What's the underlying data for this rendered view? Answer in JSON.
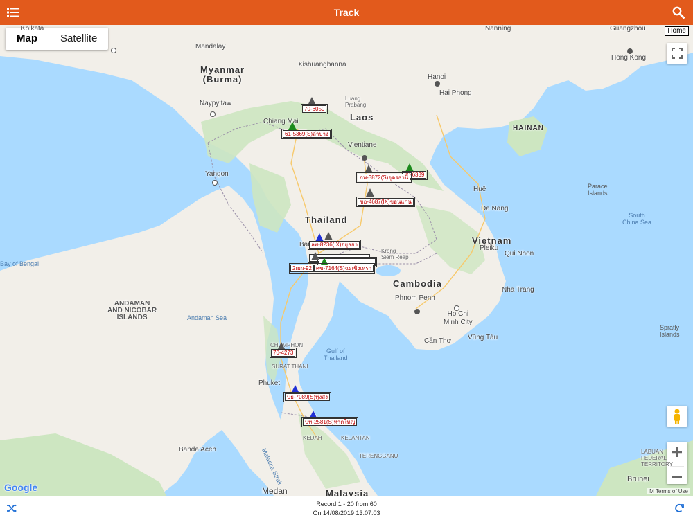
{
  "header": {
    "title": "Track"
  },
  "map_toggle": {
    "map": "Map",
    "satellite": "Satellite",
    "selected": "Map"
  },
  "home_label": "Home",
  "labels": {
    "myanmar": "Myanmar\n(Burma)",
    "laos": "Laos",
    "thailand": "Thailand",
    "cambodia": "Cambodia",
    "vietnam": "Vietnam",
    "malaysia": "Malaysia",
    "hainan": "HAINAN",
    "mandalay": "Mandalay",
    "naypyitaw": "Naypyitaw",
    "yangon": "Yangon",
    "chiang_mai": "Chiang Mai",
    "vientiane": "Vientiane",
    "hanoi": "Hanoi",
    "hai_phong": "Hai Phong",
    "hong_kong": "Hong Kong",
    "nanning": "Nanning",
    "guangzhou": "Guangzhou",
    "da_nang": "Da Nang",
    "hue": "Huế",
    "pleiku": "Pleiku",
    "qui_nhon": "Qui Nhon",
    "nha_trang": "Nha Trang",
    "ho_chi_minh": "Ho Chi\nMinh City",
    "phnom_penh": "Phnom Penh",
    "siem_reap": "Krong\nSiem Reap",
    "can_tho": "Cần Thơ",
    "vung_tau": "Vũng Tàu",
    "bangkok": "Bangkok",
    "banda_aceh": "Banda Aceh",
    "medan": "Medan",
    "kolkata": "Kolkata",
    "andaman_islands": "ANDAMAN\nAND NICOBAR\nISLANDS",
    "andaman_sea": "Andaman Sea",
    "gulf_thailand": "Gulf of\nThailand",
    "bay_bengal": "Bay of Bengal",
    "south_china_sea": "South\nChina Sea",
    "paracel": "Paracel\nIslands",
    "spratly": "Spratly\nIslands",
    "brunei": "Brunei",
    "malacca": "Malacca Strait",
    "xishuangbanna": "Xishuangbanna",
    "luang_prabang": "Luang\nPrabang",
    "surat_thani": "SURAT THANI",
    "chumphon": "CHUMPHON",
    "phuket": "Phuket",
    "kedah": "KEDAH",
    "kelantan": "KELANTAN",
    "terengganu": "TERENGGANU",
    "sabah": "LABUAN\nFEDERAL\nTERRITORY"
  },
  "vehicles": [
    {
      "id": "v1",
      "label": "70-6059",
      "color": "gray"
    },
    {
      "id": "v2",
      "label": "61-5369(S)ลำปาง",
      "color": "green"
    },
    {
      "id": "v3",
      "label": "70-6339",
      "color": "green"
    },
    {
      "id": "v4",
      "label": "กพ-3872(S)อุดรธานี",
      "color": "gray"
    },
    {
      "id": "v5",
      "label": "ขอ-4687(IX)ขอนแก่น",
      "color": "gray"
    },
    {
      "id": "v6",
      "label": "ลพ-8236(IX)อยุธยา",
      "color": "blue"
    },
    {
      "id": "v7",
      "label": "2ฒผ-92",
      "color": "gray"
    },
    {
      "id": "v8",
      "label": "ศข-7164(S)ฉะเชิงเทรา",
      "color": "green"
    },
    {
      "id": "v9",
      "label": "70-4273",
      "color": "gray"
    },
    {
      "id": "v10",
      "label": "บธ-7089(S)ทุ่งสง",
      "color": "blue"
    },
    {
      "id": "v11",
      "label": "บท-2581(S)หาดใหญ่",
      "color": "blue"
    }
  ],
  "map_footer": {
    "google": "Google",
    "terms": "Terms of Use",
    "data": "M"
  },
  "footer": {
    "record": "Record 1 - 20 from 60",
    "date": "On 14/08/2019 13:07:03"
  },
  "colors": {
    "accent": "#e25a1c",
    "water": "#aadaff",
    "land": "#f2efe9",
    "forest": "#cde6c1"
  }
}
